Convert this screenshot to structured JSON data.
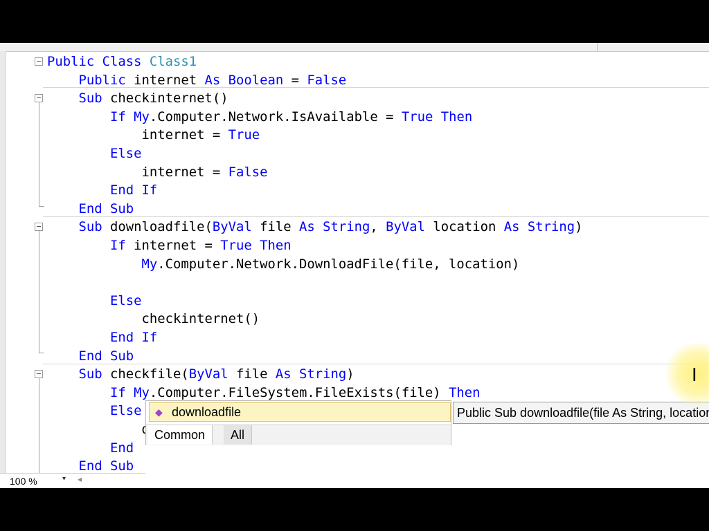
{
  "editor": {
    "lines": [
      [
        {
          "t": "Public",
          "c": "kw"
        },
        {
          "t": " "
        },
        {
          "t": "Class",
          "c": "kw"
        },
        {
          "t": " "
        },
        {
          "t": "Class1",
          "c": "ty"
        }
      ],
      [
        {
          "t": "    "
        },
        {
          "t": "Public",
          "c": "kw"
        },
        {
          "t": " internet "
        },
        {
          "t": "As",
          "c": "kw"
        },
        {
          "t": " "
        },
        {
          "t": "Boolean",
          "c": "kw"
        },
        {
          "t": " = "
        },
        {
          "t": "False",
          "c": "kw"
        }
      ],
      [
        {
          "t": "    "
        },
        {
          "t": "Sub",
          "c": "kw"
        },
        {
          "t": " checkinternet()"
        }
      ],
      [
        {
          "t": "        "
        },
        {
          "t": "If",
          "c": "kw"
        },
        {
          "t": " "
        },
        {
          "t": "My",
          "c": "kw"
        },
        {
          "t": ".Computer.Network.IsAvailable = "
        },
        {
          "t": "True",
          "c": "kw"
        },
        {
          "t": " "
        },
        {
          "t": "Then",
          "c": "kw"
        }
      ],
      [
        {
          "t": "            internet = "
        },
        {
          "t": "True",
          "c": "kw"
        }
      ],
      [
        {
          "t": "        "
        },
        {
          "t": "Else",
          "c": "kw"
        }
      ],
      [
        {
          "t": "            internet = "
        },
        {
          "t": "False",
          "c": "kw"
        }
      ],
      [
        {
          "t": "        "
        },
        {
          "t": "End If",
          "c": "kw"
        }
      ],
      [
        {
          "t": "    "
        },
        {
          "t": "End Sub",
          "c": "kw"
        }
      ],
      [
        {
          "t": "    "
        },
        {
          "t": "Sub",
          "c": "kw"
        },
        {
          "t": " downloadfile("
        },
        {
          "t": "ByVal",
          "c": "kw"
        },
        {
          "t": " file "
        },
        {
          "t": "As",
          "c": "kw"
        },
        {
          "t": " "
        },
        {
          "t": "String",
          "c": "kw"
        },
        {
          "t": ", "
        },
        {
          "t": "ByVal",
          "c": "kw"
        },
        {
          "t": " location "
        },
        {
          "t": "As",
          "c": "kw"
        },
        {
          "t": " "
        },
        {
          "t": "String",
          "c": "kw"
        },
        {
          "t": ")"
        }
      ],
      [
        {
          "t": "        "
        },
        {
          "t": "If",
          "c": "kw"
        },
        {
          "t": " internet = "
        },
        {
          "t": "True",
          "c": "kw"
        },
        {
          "t": " "
        },
        {
          "t": "Then",
          "c": "kw"
        }
      ],
      [
        {
          "t": "            "
        },
        {
          "t": "My",
          "c": "kw"
        },
        {
          "t": ".Computer.Network.DownloadFile(file, location)"
        }
      ],
      [
        {
          "t": ""
        }
      ],
      [
        {
          "t": "        "
        },
        {
          "t": "Else",
          "c": "kw"
        }
      ],
      [
        {
          "t": "            checkinternet()"
        }
      ],
      [
        {
          "t": "        "
        },
        {
          "t": "End If",
          "c": "kw"
        }
      ],
      [
        {
          "t": "    "
        },
        {
          "t": "End Sub",
          "c": "kw"
        }
      ],
      [
        {
          "t": "    "
        },
        {
          "t": "Sub",
          "c": "kw"
        },
        {
          "t": " checkfile("
        },
        {
          "t": "ByVal",
          "c": "kw"
        },
        {
          "t": " file "
        },
        {
          "t": "As",
          "c": "kw"
        },
        {
          "t": " "
        },
        {
          "t": "String",
          "c": "kw"
        },
        {
          "t": ")"
        }
      ],
      [
        {
          "t": "        "
        },
        {
          "t": "If",
          "c": "kw"
        },
        {
          "t": " "
        },
        {
          "t": "My",
          "c": "kw"
        },
        {
          "t": ".Computer.FileSystem.FileExists(file) "
        },
        {
          "t": "Then",
          "c": "kw"
        }
      ],
      [
        {
          "t": "        "
        },
        {
          "t": "Else",
          "c": "kw"
        }
      ],
      [
        {
          "t": "            downloadfile"
        }
      ],
      [
        {
          "t": "        "
        },
        {
          "t": "End",
          "c": "kw"
        }
      ],
      [
        {
          "t": "    "
        },
        {
          "t": "End Sub",
          "c": "kw"
        }
      ]
    ]
  },
  "statusbar": {
    "zoom": "100 %",
    "zoom_arrow": "▾",
    "scroll_arrow": "◂"
  },
  "autocomplete": {
    "selected_item": "downloadfile",
    "icon": "method-icon",
    "icon_glyph": "◆",
    "tab_common": "Common",
    "tab_all": "All"
  },
  "tooltip": {
    "text": "Public Sub downloadfile(file As String, location As String)"
  },
  "cursor": {
    "glyph": "I"
  }
}
